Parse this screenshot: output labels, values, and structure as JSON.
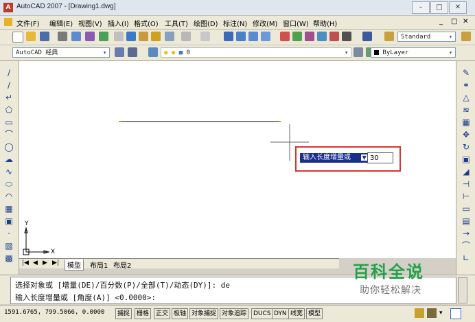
{
  "window": {
    "title": "AutoCAD 2007 - [Drawing1.dwg]"
  },
  "menu": {
    "items": [
      "文件(F)",
      "编辑(E)",
      "视图(V)",
      "插入(I)",
      "格式(O)",
      "工具(T)",
      "绘图(D)",
      "标注(N)",
      "修改(M)",
      "窗口(W)",
      "帮助(H)"
    ]
  },
  "toolbar": {
    "text_style": "Standard",
    "workspace": "AutoCAD 经典",
    "layer": "0",
    "linetype": "ByLayer"
  },
  "dynamic_input": {
    "prompt": "输入长度增量或",
    "value": "30"
  },
  "tabs": [
    "模型",
    "布局1",
    "布局2"
  ],
  "ucs": {
    "x_label": "X",
    "y_label": "Y"
  },
  "command": {
    "line1": "选择对象或 [增量(DE)/百分数(P)/全部(T)/动态(DY)]: de",
    "line2": "输入长度增量或 [角度(A)] <0.0000>:"
  },
  "status": {
    "coords": "1591.6765, 799.5066, 0.0000",
    "buttons": [
      "捕捉",
      "栅格",
      "正交",
      "极轴",
      "对象捕捉",
      "对象追踪",
      "DUCS",
      "DYN",
      "线宽",
      "模型"
    ]
  },
  "watermark": {
    "line1": "百科全说",
    "line2": "助你轻松解决"
  },
  "colors": {
    "accent": "#d9342b",
    "prompt_bg": "#1a2f8c",
    "watermark": "#22a14a"
  }
}
